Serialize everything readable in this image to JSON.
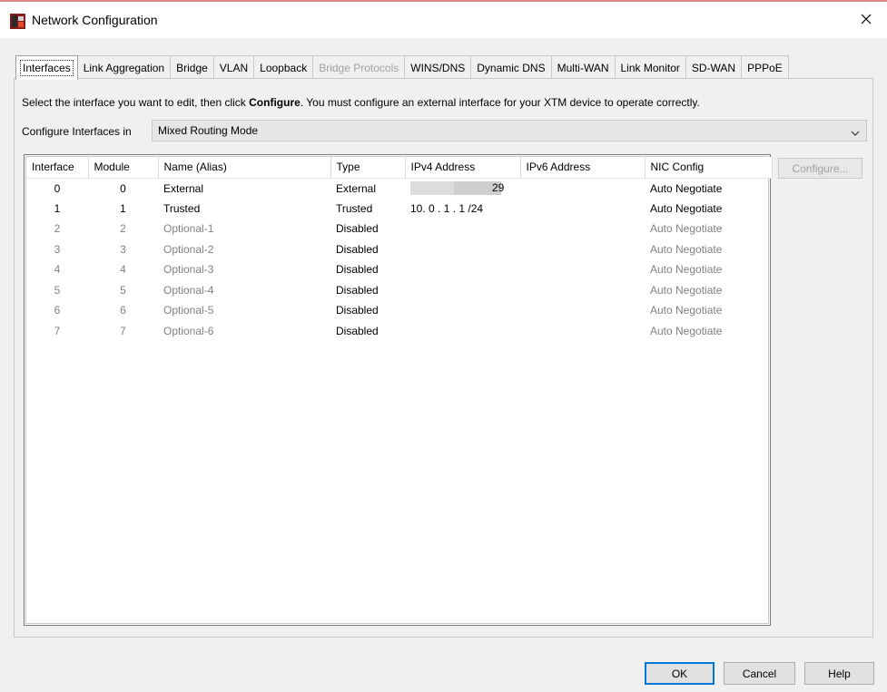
{
  "window": {
    "title": "Network Configuration",
    "app_icon": "watchguard-icon",
    "close_icon": "close-icon"
  },
  "tabs": [
    {
      "label": "Interfaces",
      "state": "active"
    },
    {
      "label": "Link Aggregation",
      "state": "normal"
    },
    {
      "label": "Bridge",
      "state": "normal"
    },
    {
      "label": "VLAN",
      "state": "normal"
    },
    {
      "label": "Loopback",
      "state": "normal"
    },
    {
      "label": "Bridge Protocols",
      "state": "disabled"
    },
    {
      "label": "WINS/DNS",
      "state": "normal"
    },
    {
      "label": "Dynamic DNS",
      "state": "normal"
    },
    {
      "label": "Multi-WAN",
      "state": "normal"
    },
    {
      "label": "Link Monitor",
      "state": "normal"
    },
    {
      "label": "SD-WAN",
      "state": "normal"
    },
    {
      "label": "PPPoE",
      "state": "normal"
    }
  ],
  "instructions": {
    "before": "Select the interface you want to edit, then click ",
    "bold": "Configure",
    "after": ". You must configure an external interface for your XTM device to operate correctly."
  },
  "configure_in": {
    "label": "Configure Interfaces in",
    "value": "Mixed Routing Mode"
  },
  "table": {
    "columns": [
      "Interface",
      "Module",
      "Name (Alias)",
      "Type",
      "IPv4 Address",
      "IPv6 Address",
      "NIC Config"
    ],
    "rows": [
      {
        "interface": "0",
        "module": "0",
        "name": "External",
        "type": "External",
        "ipv4": "29",
        "ipv4_redacted": true,
        "ipv6": "",
        "nic": "Auto Negotiate",
        "dim": false
      },
      {
        "interface": "1",
        "module": "1",
        "name": "Trusted",
        "type": "Trusted",
        "ipv4": "10. 0 . 1 . 1 /24",
        "ipv4_redacted": false,
        "ipv6": "",
        "nic": "Auto Negotiate",
        "dim": false
      },
      {
        "interface": "2",
        "module": "2",
        "name": "Optional-1",
        "type": "Disabled",
        "ipv4": "",
        "ipv4_redacted": false,
        "ipv6": "",
        "nic": "Auto Negotiate",
        "dim": true
      },
      {
        "interface": "3",
        "module": "3",
        "name": "Optional-2",
        "type": "Disabled",
        "ipv4": "",
        "ipv4_redacted": false,
        "ipv6": "",
        "nic": "Auto Negotiate",
        "dim": true
      },
      {
        "interface": "4",
        "module": "4",
        "name": "Optional-3",
        "type": "Disabled",
        "ipv4": "",
        "ipv4_redacted": false,
        "ipv6": "",
        "nic": "Auto Negotiate",
        "dim": true
      },
      {
        "interface": "5",
        "module": "5",
        "name": "Optional-4",
        "type": "Disabled",
        "ipv4": "",
        "ipv4_redacted": false,
        "ipv6": "",
        "nic": "Auto Negotiate",
        "dim": true
      },
      {
        "interface": "6",
        "module": "6",
        "name": "Optional-5",
        "type": "Disabled",
        "ipv4": "",
        "ipv4_redacted": false,
        "ipv6": "",
        "nic": "Auto Negotiate",
        "dim": true
      },
      {
        "interface": "7",
        "module": "7",
        "name": "Optional-6",
        "type": "Disabled",
        "ipv4": "",
        "ipv4_redacted": false,
        "ipv6": "",
        "nic": "Auto Negotiate",
        "dim": true
      }
    ]
  },
  "buttons": {
    "configure": "Configure...",
    "ok": "OK",
    "cancel": "Cancel",
    "help": "Help"
  },
  "colors": {
    "dim_text": "#808080",
    "disabled_text": "#a0a0a0",
    "default_button_border": "#0078d7"
  }
}
